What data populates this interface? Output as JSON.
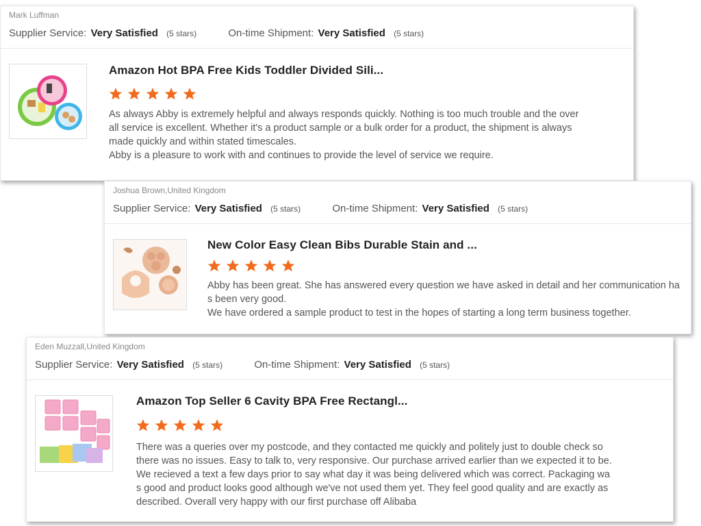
{
  "colors": {
    "star": "#f26b1d",
    "border": "#e6e6e6"
  },
  "reviews": [
    {
      "reviewer": "Mark Luffman",
      "supplier_service_label": "Supplier Service:",
      "supplier_service_value": "Very Satisfied",
      "supplier_service_stars": "(5 stars)",
      "shipment_label": "On-time Shipment:",
      "shipment_value": "Very Satisfied",
      "shipment_stars": "(5 stars)",
      "product_title": "Amazon Hot BPA Free Kids Toddler Divided Sili...",
      "rating": 5,
      "image_icon": "divided-plates-product-icon",
      "review_text": "As always Abby is extremely helpful and always responds quickly. Nothing is too much trouble and the over\nall service is excellent. Whether it's a product sample or a bulk order for a product, the shipment is always\nmade quickly and within stated timescales.\nAbby is a pleasure to work with and continues to provide the level of service we require."
    },
    {
      "reviewer": "Joshua Brown,United Kingdom",
      "supplier_service_label": "Supplier Service:",
      "supplier_service_value": "Very Satisfied",
      "supplier_service_stars": "(5 stars)",
      "shipment_label": "On-time Shipment:",
      "shipment_value": "Very Satisfied",
      "shipment_stars": "(5 stars)",
      "product_title": "New Color Easy Clean Bibs Durable Stain and ...",
      "rating": 5,
      "image_icon": "baby-bib-set-product-icon",
      "review_text": "Abby has been great. She has answered every question we have asked in detail and her communication ha\ns been very good.\nWe have ordered a sample product to test in the hopes of starting a long term business together."
    },
    {
      "reviewer": "Eden Muzzall,United Kingdom",
      "supplier_service_label": "Supplier Service:",
      "supplier_service_value": "Very Satisfied",
      "supplier_service_stars": "(5 stars)",
      "shipment_label": "On-time Shipment:",
      "shipment_value": "Very Satisfied",
      "shipment_stars": "(5 stars)",
      "product_title": "Amazon Top Seller 6 Cavity BPA Free Rectangl...",
      "rating": 5,
      "image_icon": "soap-mold-product-icon",
      "review_text": "There was a queries over my postcode, and they contacted me quickly and politely just to double check so\nthere was no issues. Easy to talk to, very responsive. Our purchase arrived earlier than we expected it to be.\nWe recieved a text a few days prior to say what day it was being delivered which was correct. Packaging wa\ns good and product looks good although we've not used them yet. They feel good quality and are exactly as\ndescribed. Overall very happy with our first purchase off Alibaba"
    }
  ]
}
